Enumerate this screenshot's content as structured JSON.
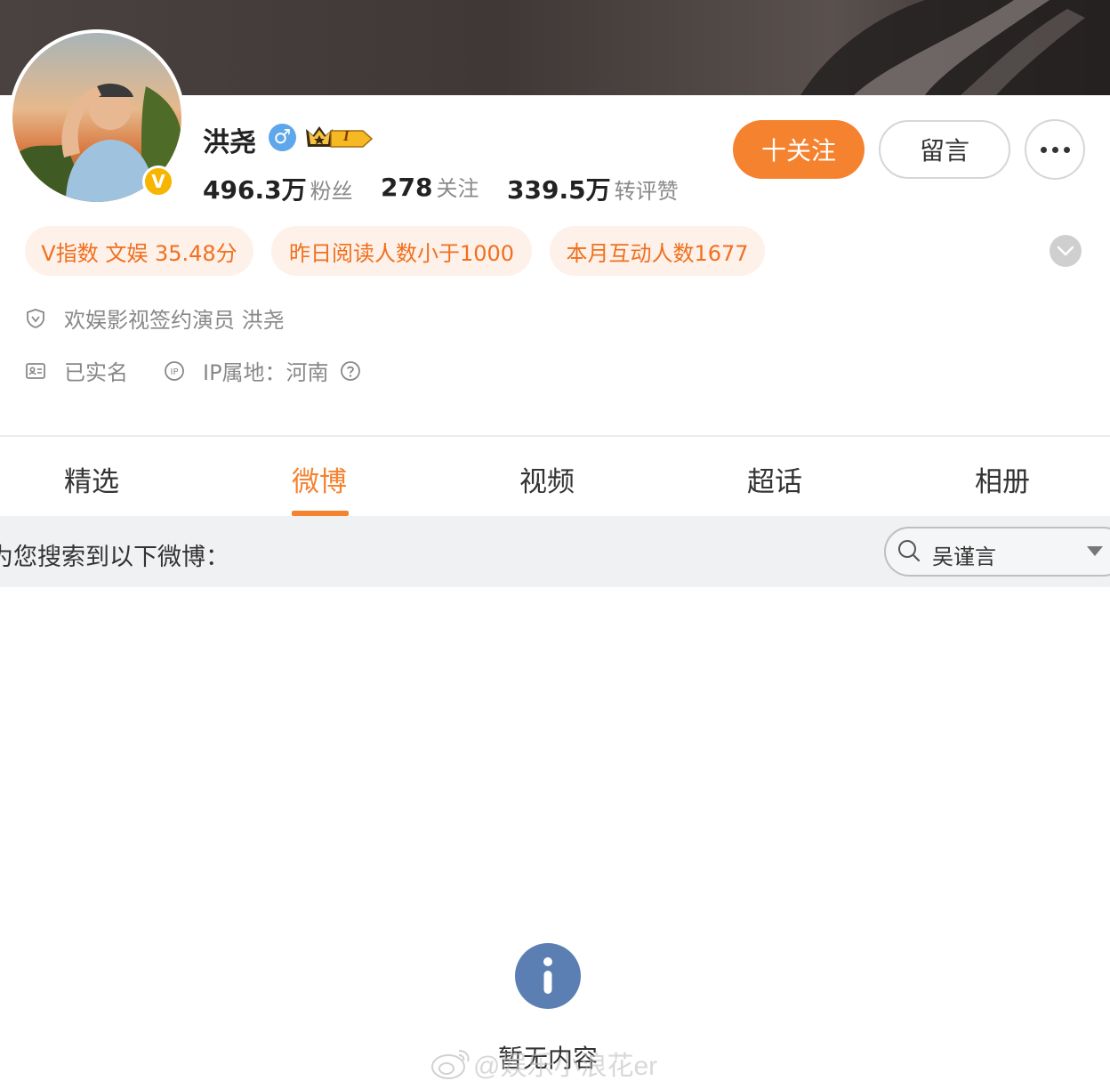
{
  "profile": {
    "name": "洪尧",
    "gender_icon": "♂",
    "vip_label": "I",
    "verified_badge": "V",
    "stats": [
      {
        "value": "496.3万",
        "label": "粉丝"
      },
      {
        "value": "278",
        "label": "关注"
      },
      {
        "value": "339.5万",
        "label": "转评赞"
      }
    ],
    "follow_label": "十关注",
    "message_label": "留言"
  },
  "chips": [
    "V指数 文娱 35.48分",
    "昨日阅读人数小于1000",
    "本月互动人数1677"
  ],
  "info": {
    "verification": "欢娱影视签约演员 洪尧",
    "realname": "已实名",
    "ip_location": "IP属地：河南"
  },
  "tabs": [
    {
      "label": "精选",
      "active": false
    },
    {
      "label": "微博",
      "active": true
    },
    {
      "label": "视频",
      "active": false
    },
    {
      "label": "超话",
      "active": false
    },
    {
      "label": "相册",
      "active": false
    }
  ],
  "search": {
    "result_text": "为您搜索到以下微博：",
    "filter_value": "吴谨言"
  },
  "empty_state": {
    "icon": "info-icon",
    "text": "暂无内容"
  },
  "watermark": "@娱乐小浪花er",
  "colors": {
    "accent": "#f5822f",
    "chip_bg": "#fdf1ea",
    "chip_text": "#f0701e",
    "verified": "#f7b500",
    "info_icon": "#5b7fb3"
  }
}
